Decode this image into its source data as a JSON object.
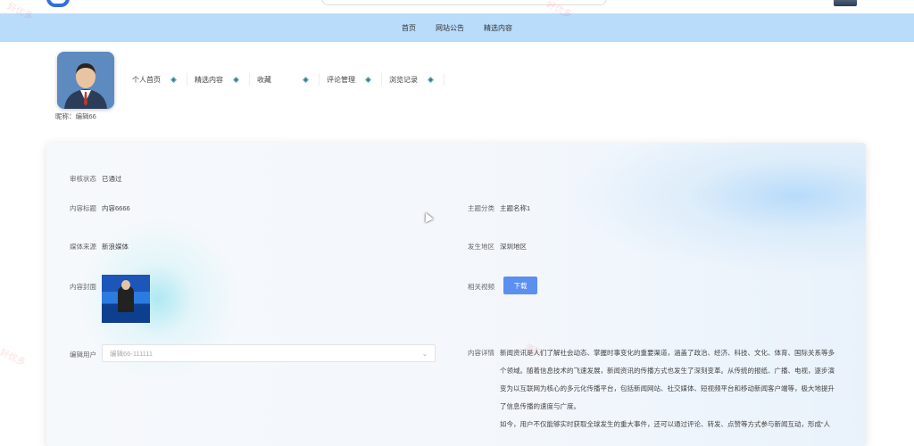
{
  "nav": {
    "items": [
      "首页",
      "网站公告",
      "精选内容"
    ]
  },
  "profile": {
    "nickname": "昵称：编辑66"
  },
  "user_menu": [
    "个人首页",
    "精选内容",
    "收藏",
    "评论管理",
    "浏览记录"
  ],
  "detail": {
    "status_label": "审核状态",
    "status_value": "已通过",
    "title_label": "内容标题",
    "title_value": "内容6666",
    "topic_label": "主题分类",
    "topic_value": "主题名称1",
    "media_label": "媒体来源",
    "media_value": "新浪媒体",
    "region_label": "发生地区",
    "region_value": "深圳地区",
    "cover_label": "内容封面",
    "video_label": "相关视频",
    "download_label": "下载",
    "editor_label": "编辑用户",
    "editor_value": "编辑66-111111",
    "content_label": "内容详情",
    "content_p1": "新闻资讯是人们了解社会动态、掌握时事变化的重要渠道，涵盖了政治、经济、科技、文化、体育、国际关系等多个领域。随着信息技术的飞速发展，新闻资讯的传播方式也发生了深刻变革。从传统的报纸、广播、电视，逐步演变为以互联网为核心的多元化传播平台，包括新闻网站、社交媒体、短视频平台和移动新闻客户端等，极大地提升了信息传播的速度与广度。",
    "content_p2": "如今，用户不仅能够实时获取全球发生的重大事件，还可以通过评论、转发、点赞等方式参与新闻互动，形成“人"
  },
  "colors": {
    "navbar": "#b9dcfb",
    "button": "#5b8ff0"
  }
}
